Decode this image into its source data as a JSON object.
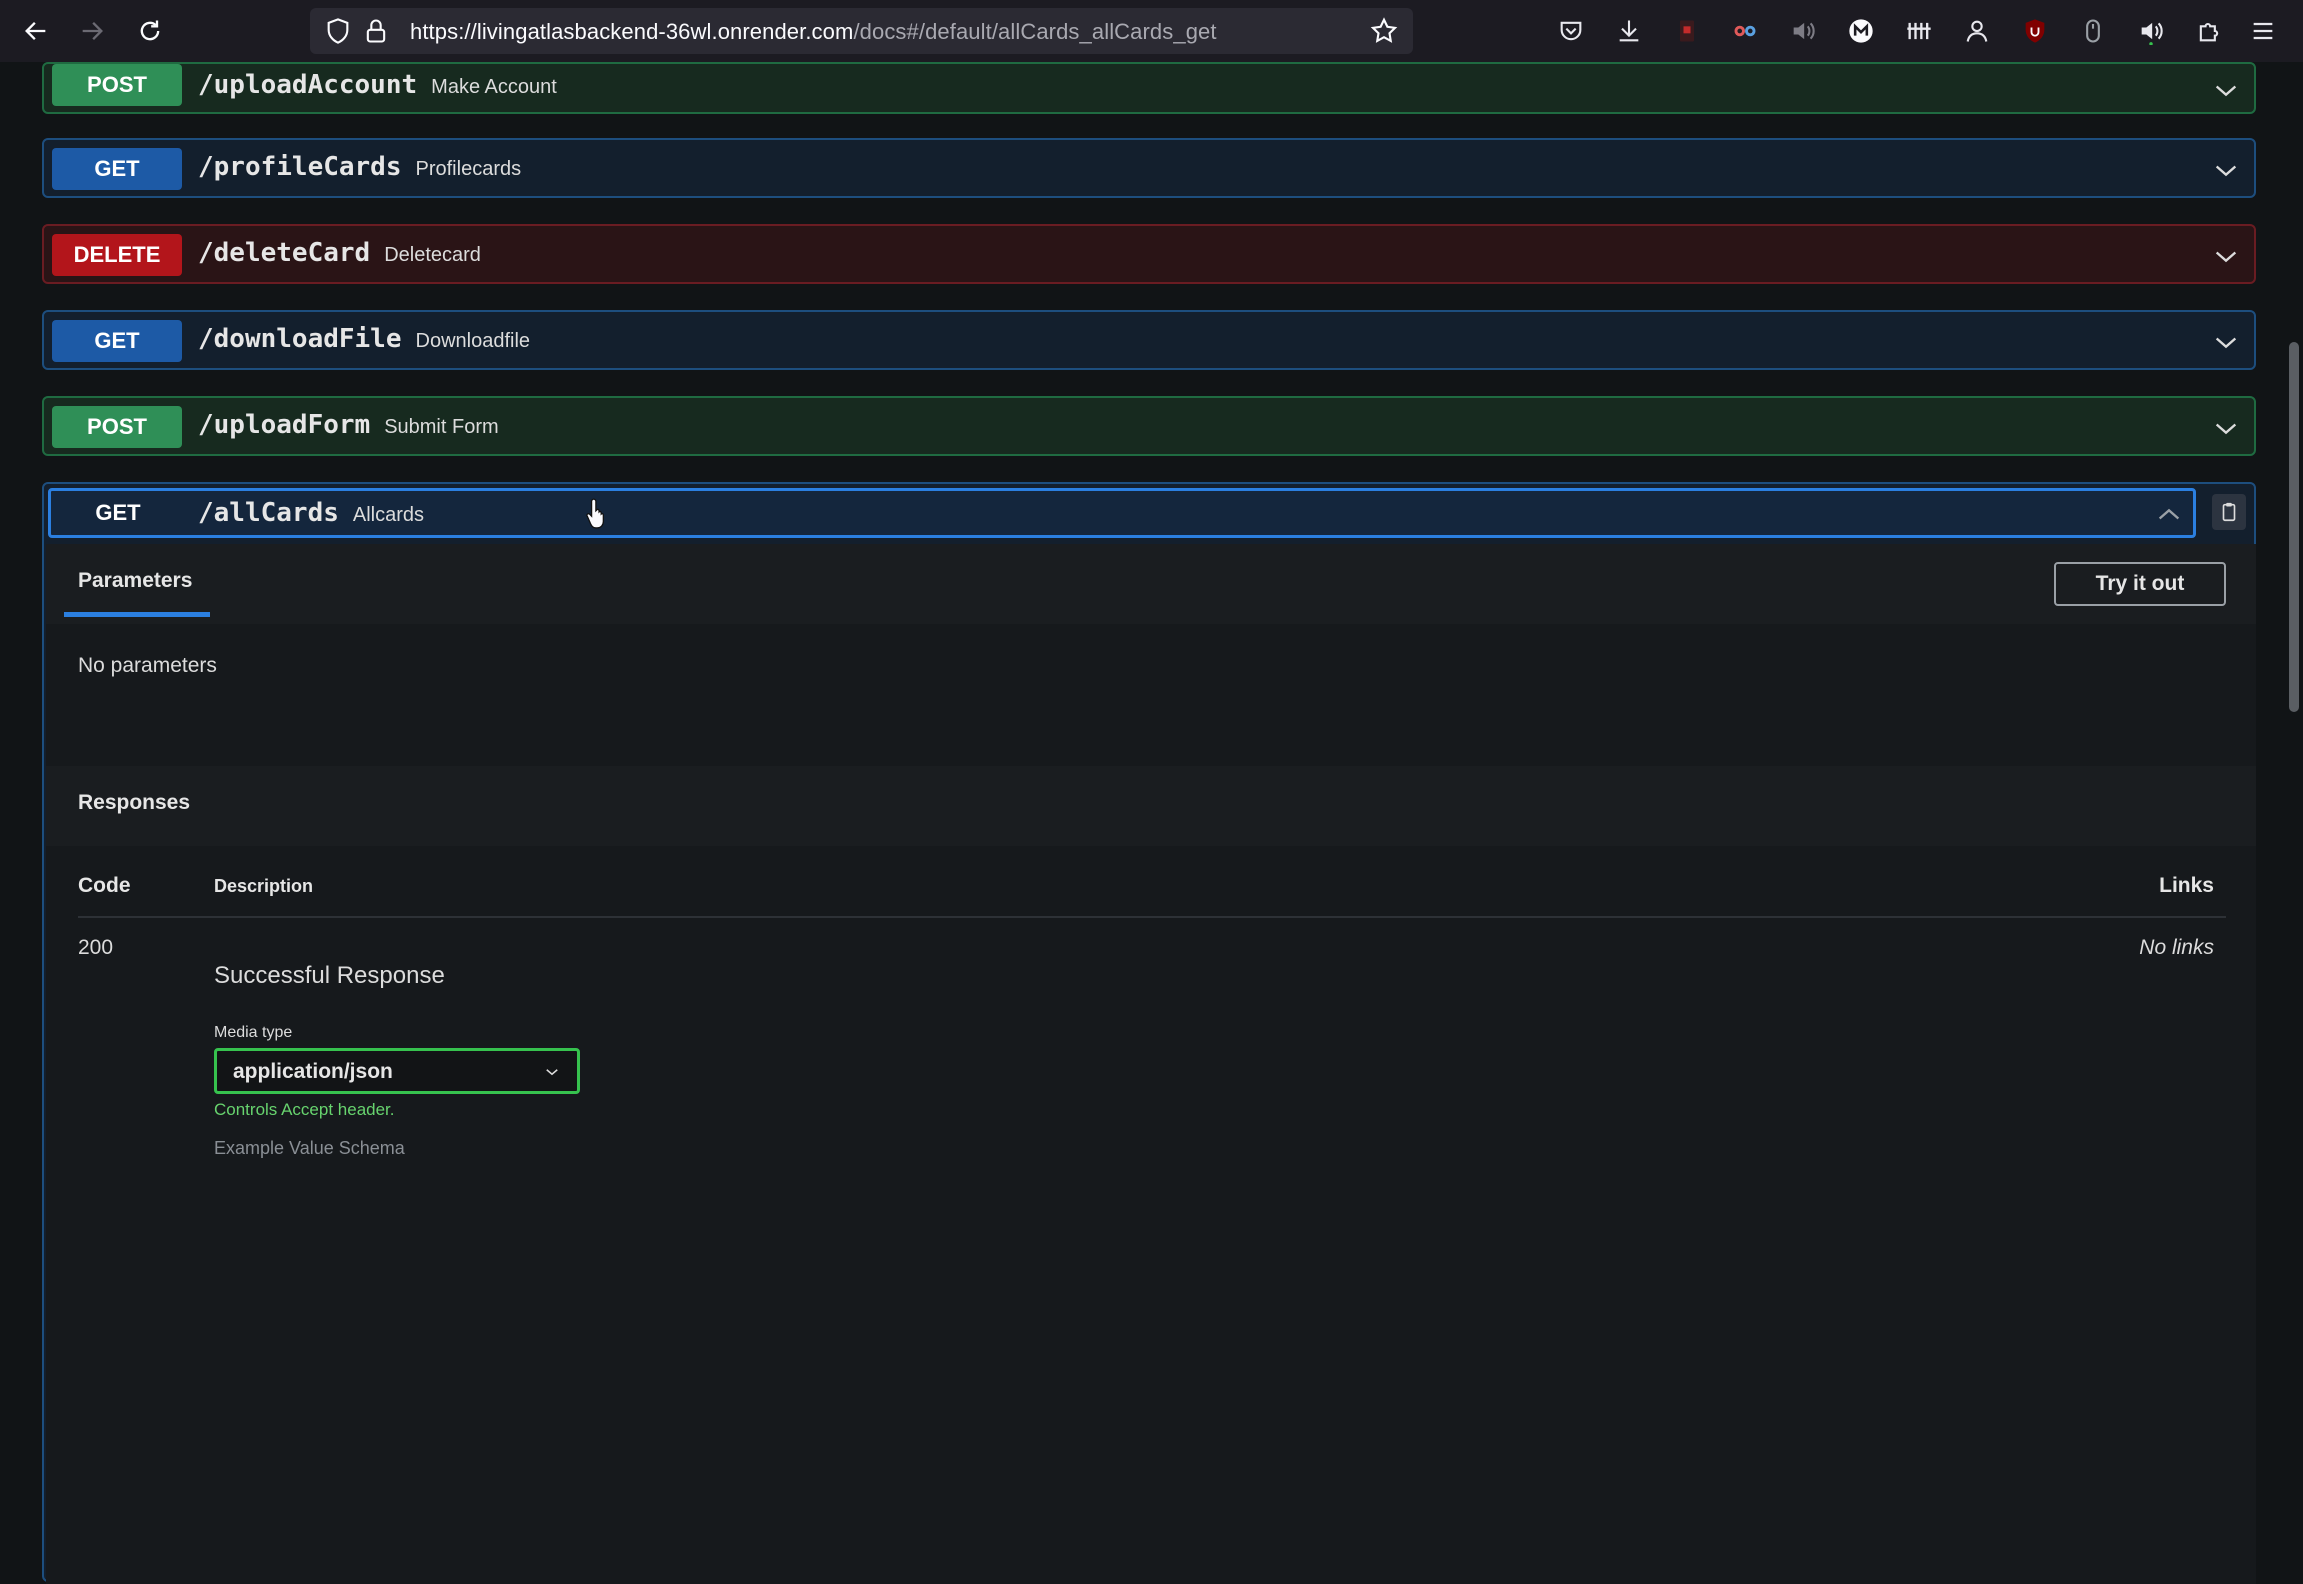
{
  "browser": {
    "url_host": "https://livingatlasbackend-36wl.onrender.com",
    "url_path": "/docs#/default/allCards_allCards_get",
    "extensions": [
      "pocket-icon",
      "download-icon",
      "pdf-icon",
      "eyes-icon",
      "volume-muted-icon",
      "m-icon",
      "bars-icon",
      "user-ghost-icon",
      "ublock-icon",
      "mouse-icon",
      "speaker-icon",
      "puzzle-icon",
      "menu-icon"
    ]
  },
  "operations": [
    {
      "method": "POST",
      "path": "/uploadAccount",
      "summary": "Make Account"
    },
    {
      "method": "GET",
      "path": "/profileCards",
      "summary": "Profilecards"
    },
    {
      "method": "DELETE",
      "path": "/deleteCard",
      "summary": "Deletecard"
    },
    {
      "method": "GET",
      "path": "/downloadFile",
      "summary": "Downloadfile"
    },
    {
      "method": "POST",
      "path": "/uploadForm",
      "summary": "Submit Form"
    }
  ],
  "open_operation": {
    "method": "GET",
    "path": "/allCards",
    "summary": "Allcards",
    "parameters_tab": "Parameters",
    "try_button": "Try it out",
    "no_parameters": "No parameters",
    "responses_title": "Responses",
    "table_headers": {
      "code": "Code",
      "description": "Description",
      "links": "Links"
    },
    "responses": [
      {
        "code": "200",
        "description": "Successful Response",
        "links": "No links",
        "media_type_label": "Media type",
        "media_type": "application/json",
        "hint": "Controls Accept header.",
        "cut_text": "Example Value   Schema"
      }
    ]
  },
  "colors": {
    "post": "#2f8f57",
    "get": "#1d5aa6",
    "delete": "#b3151b",
    "focus": "#2b7fe0",
    "select_border": "#36c24e"
  }
}
